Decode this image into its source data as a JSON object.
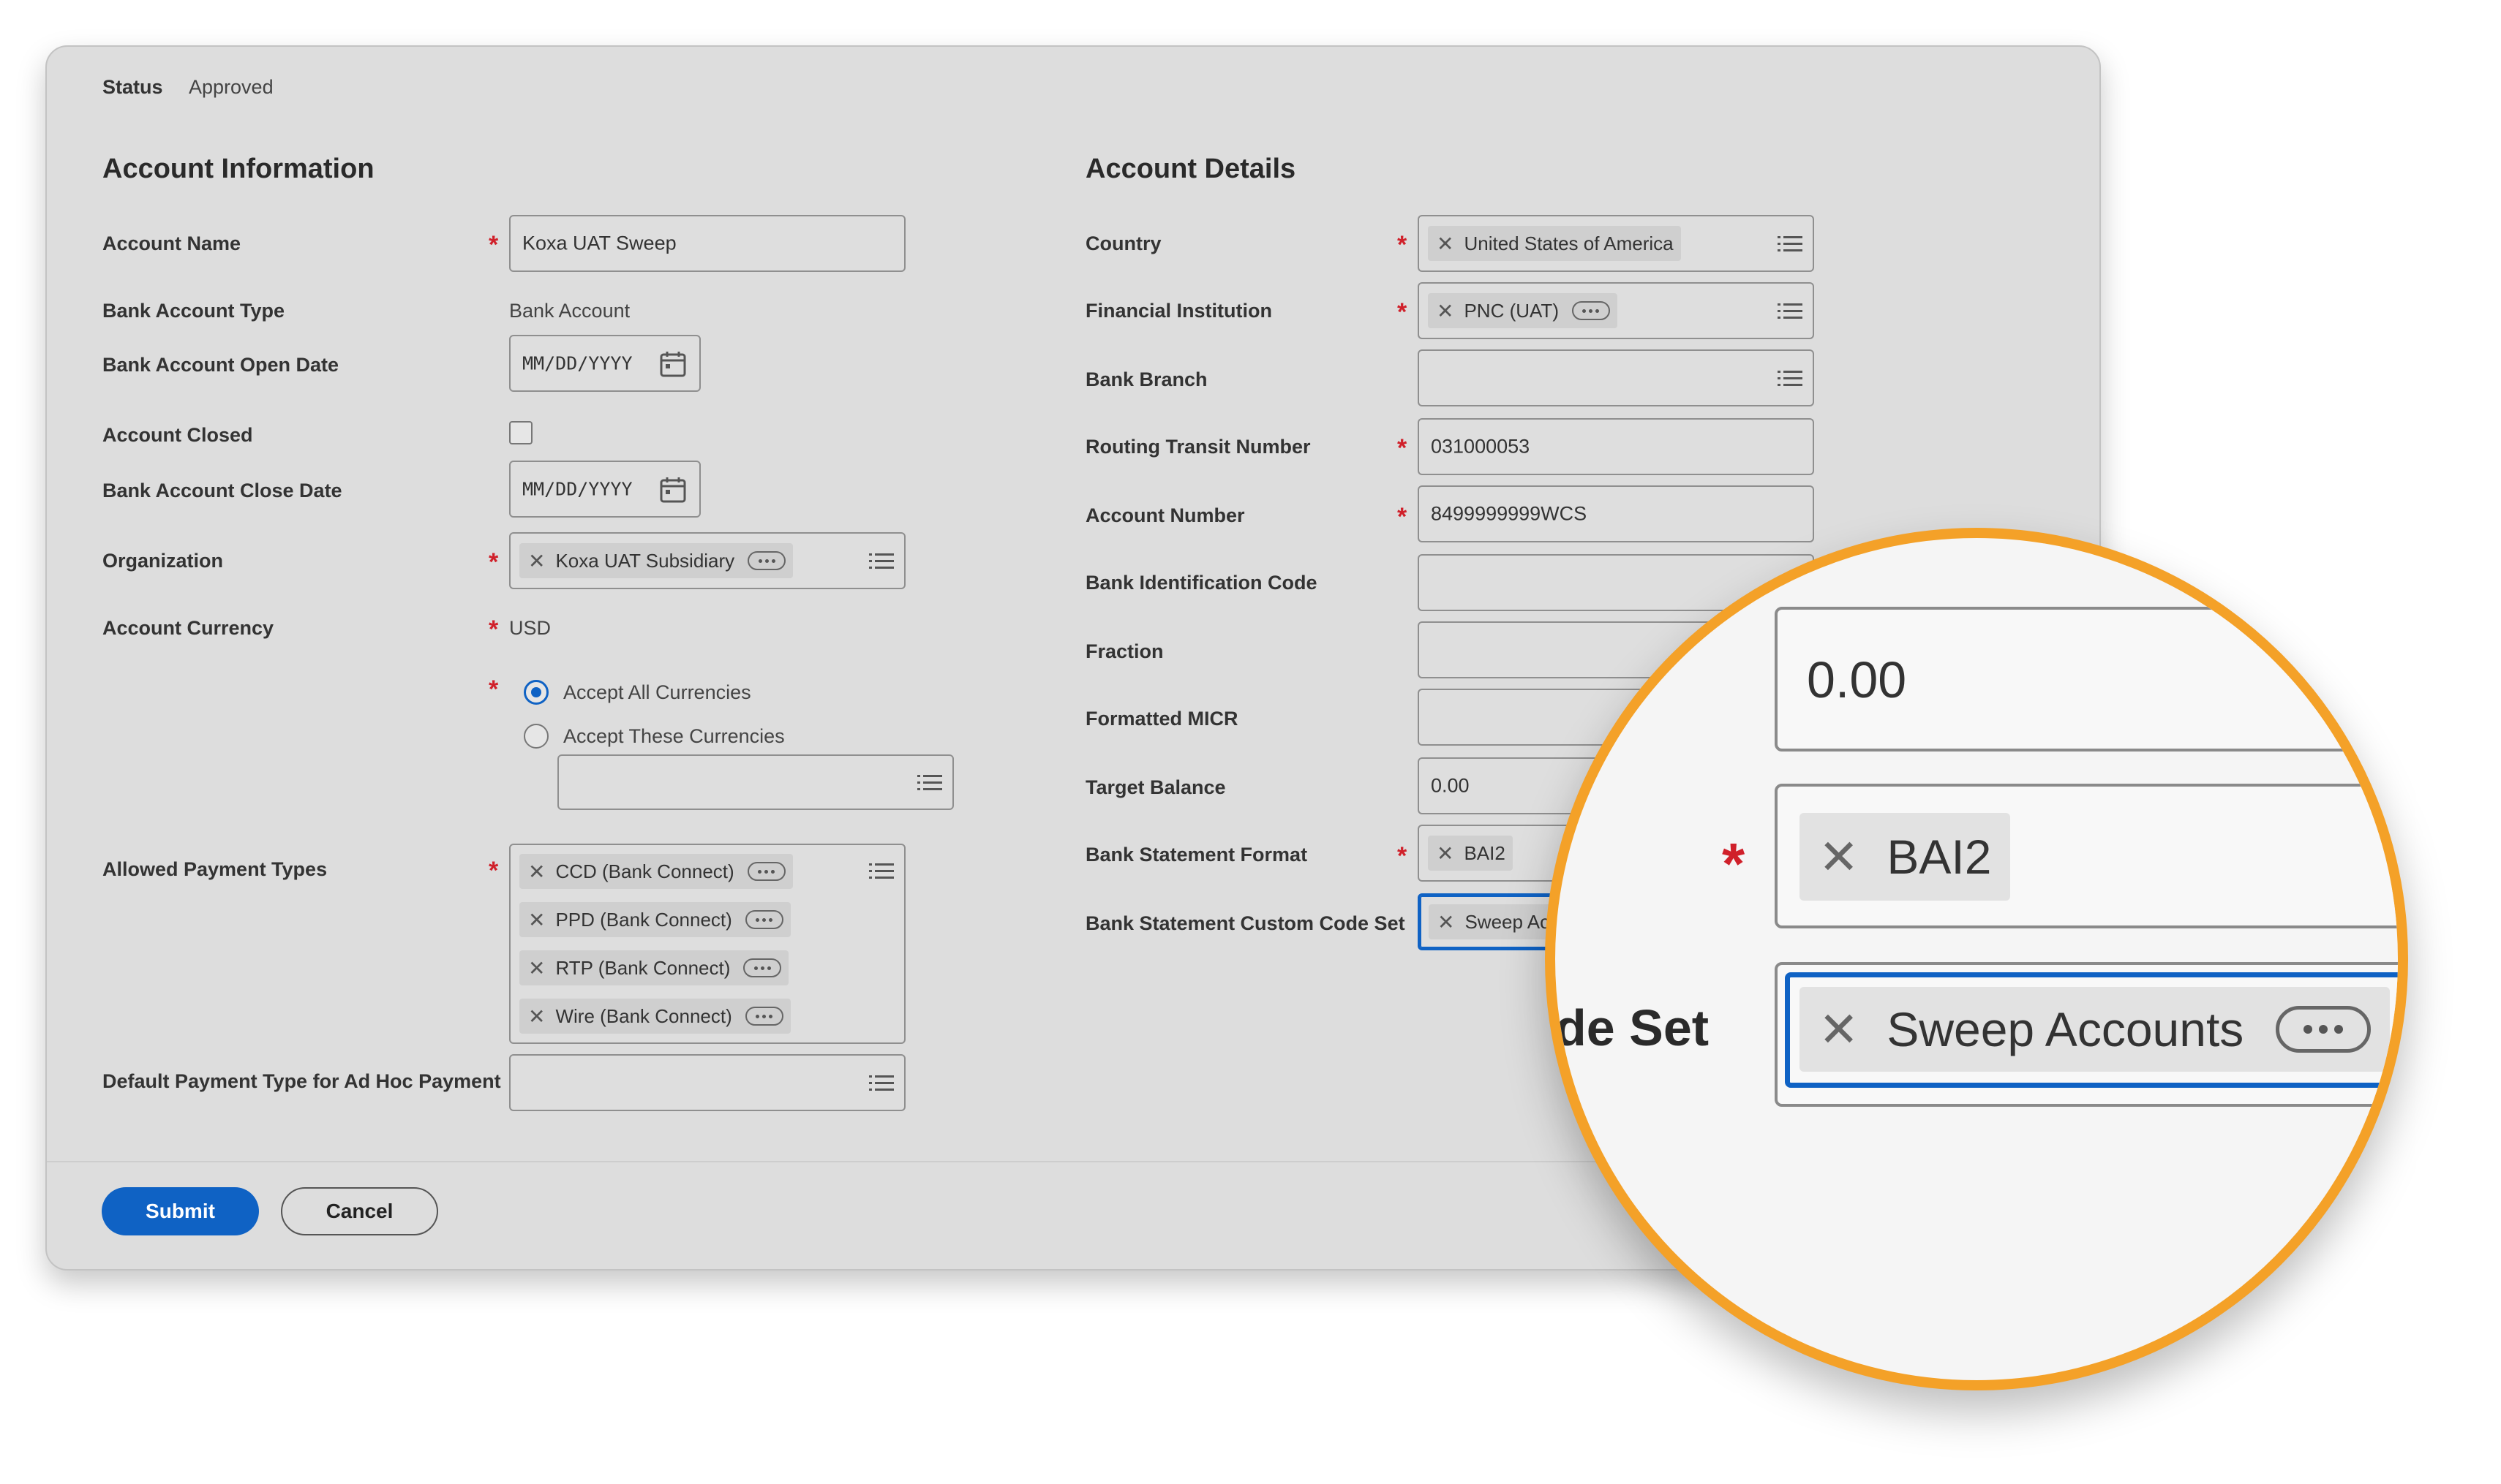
{
  "status": {
    "label": "Status",
    "value": "Approved"
  },
  "account_information": {
    "header": "Account Information",
    "account_name": {
      "label": "Account Name",
      "value": "Koxa UAT Sweep"
    },
    "bank_account_type": {
      "label": "Bank Account Type",
      "value": "Bank Account"
    },
    "open_date": {
      "label": "Bank Account Open Date",
      "placeholder": "MM/DD/YYYY"
    },
    "account_closed": {
      "label": "Account Closed"
    },
    "close_date": {
      "label": "Bank Account Close Date",
      "placeholder": "MM/DD/YYYY"
    },
    "organization": {
      "label": "Organization",
      "chip": "Koxa UAT Subsidiary"
    },
    "currency": {
      "label": "Account Currency",
      "value": "USD",
      "option_all": "Accept All Currencies",
      "option_these": "Accept These Currencies"
    },
    "payment_types": {
      "label": "Allowed Payment Types",
      "chips": [
        "CCD (Bank Connect)",
        "PPD (Bank Connect)",
        "RTP (Bank Connect)",
        "Wire (Bank Connect)"
      ]
    },
    "default_payment": {
      "label": "Default Payment Type for Ad Hoc Payment"
    }
  },
  "account_details": {
    "header": "Account Details",
    "country": {
      "label": "Country",
      "chip": "United States of America"
    },
    "financial_institution": {
      "label": "Financial Institution",
      "chip": "PNC (UAT)"
    },
    "bank_branch": {
      "label": "Bank Branch"
    },
    "routing": {
      "label": "Routing Transit Number",
      "value": "031000053"
    },
    "account_number": {
      "label": "Account Number",
      "value": "8499999999WCS"
    },
    "bic": {
      "label": "Bank Identification Code"
    },
    "fraction": {
      "label": "Fraction"
    },
    "micr": {
      "label": "Formatted MICR"
    },
    "target_balance": {
      "label": "Target Balance",
      "value": "0.00"
    },
    "statement_format": {
      "label": "Bank Statement Format",
      "chip": "BAI2"
    },
    "custom_code_set": {
      "label": "Bank Statement Custom Code Set",
      "chip_partial": "Sweep Ac"
    }
  },
  "actions": {
    "submit": "Submit",
    "cancel": "Cancel"
  },
  "magnifier": {
    "target_balance": "0.00",
    "statement_format_chip": "BAI2",
    "label_fragment": "de Set",
    "custom_code_chip": "Sweep Accounts"
  },
  "colors": {
    "accent": "#0f62c4",
    "required": "#d0202a",
    "magnifier_ring": "#f4a128"
  },
  "icons": [
    "list-icon",
    "calendar-icon",
    "close-icon",
    "more-icon",
    "radio-icon",
    "checkbox-icon"
  ]
}
